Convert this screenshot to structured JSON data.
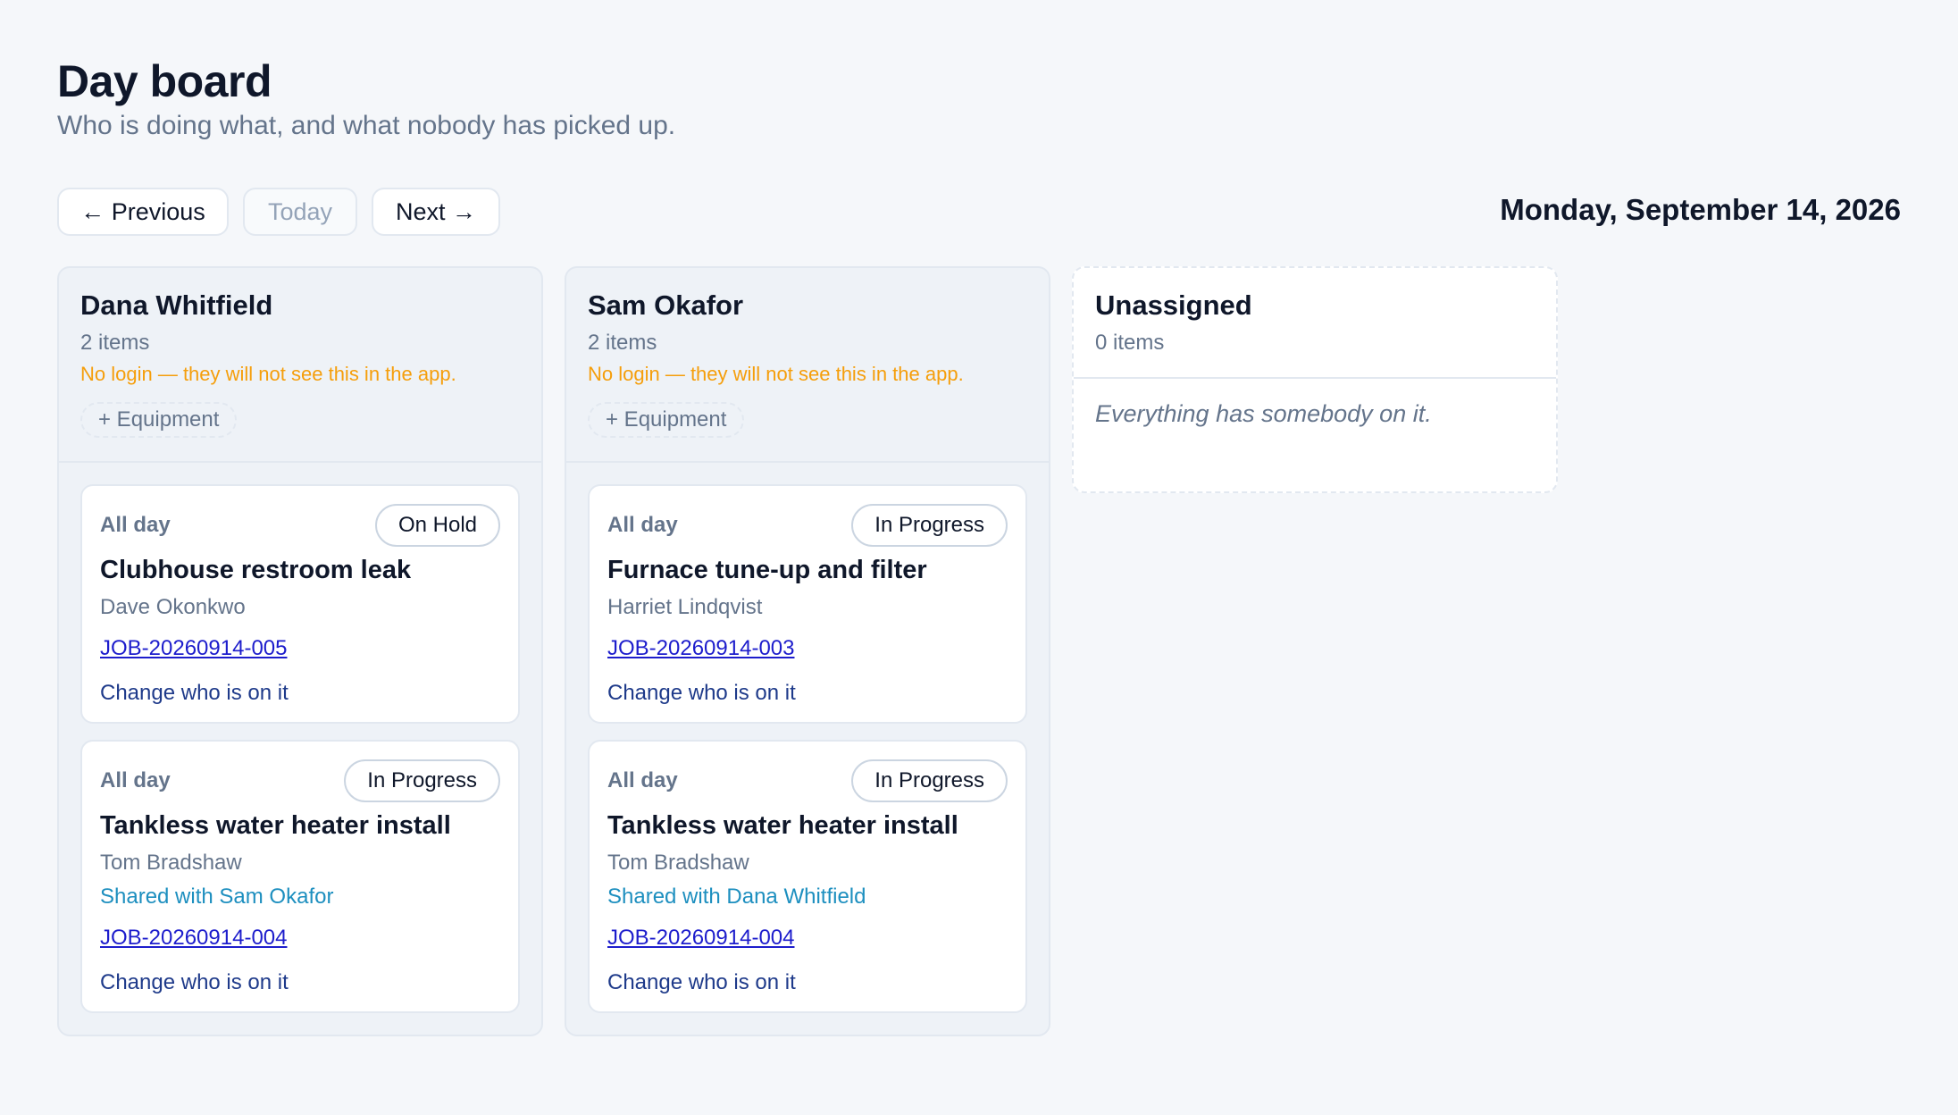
{
  "header": {
    "title": "Day board",
    "subtitle": "Who is doing what, and what nobody has picked up."
  },
  "nav": {
    "previous_label": "← Previous",
    "today_label": "Today",
    "next_label": "Next →",
    "current_date": "Monday, September 14, 2026"
  },
  "columns": [
    {
      "name": "Dana Whitfield",
      "count": "2 items",
      "warning": "No login — they will not see this in the app.",
      "equipment_label": "+ Equipment",
      "cards": [
        {
          "time": "All day",
          "status": "On Hold",
          "title": "Clubhouse restroom leak",
          "client": "Dave Okonkwo",
          "job_id": "JOB-20260914-005",
          "change_label": "Change who is on it"
        },
        {
          "time": "All day",
          "status": "In Progress",
          "title": "Tankless water heater install",
          "client": "Tom Bradshaw",
          "shared": "Shared with Sam Okafor",
          "job_id": "JOB-20260914-004",
          "change_label": "Change who is on it"
        }
      ]
    },
    {
      "name": "Sam Okafor",
      "count": "2 items",
      "warning": "No login — they will not see this in the app.",
      "equipment_label": "+ Equipment",
      "cards": [
        {
          "time": "All day",
          "status": "In Progress",
          "title": "Furnace tune-up and filter",
          "client": "Harriet Lindqvist",
          "job_id": "JOB-20260914-003",
          "change_label": "Change who is on it"
        },
        {
          "time": "All day",
          "status": "In Progress",
          "title": "Tankless water heater install",
          "client": "Tom Bradshaw",
          "shared": "Shared with Dana Whitfield",
          "job_id": "JOB-20260914-004",
          "change_label": "Change who is on it"
        }
      ]
    },
    {
      "name": "Unassigned",
      "count": "0 items",
      "empty_text": "Everything has somebody on it."
    }
  ],
  "colors": {
    "background": "#f5f7fa",
    "warning": "#f59e0b",
    "shared": "#1d8fbf",
    "link": "#1d1dcc",
    "action": "#1e3a8a"
  }
}
